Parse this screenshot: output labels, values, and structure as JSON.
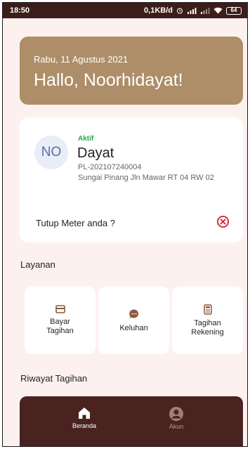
{
  "status_bar": {
    "time": "18:50",
    "network_speed": "0,1KB/d",
    "battery": "64"
  },
  "greeting": {
    "date": "Rabu, 11 Agustus 2021",
    "hello": "Hallo, Noorhidayat!"
  },
  "customer": {
    "initials": "NO",
    "status": "Aktif",
    "name": "Dayat",
    "id": "PL-202107240004",
    "address": "Sungai Pinang Jln Mawar RT 04 RW 02",
    "close_meter_label": "Tutup Meter anda ?"
  },
  "services": {
    "title": "Layanan",
    "items": [
      {
        "label": "Bayar\nTagihan",
        "icon": "card-icon"
      },
      {
        "label": "Keluhan",
        "icon": "chat-bubble-icon"
      },
      {
        "label": "Tagihan\nRekening",
        "icon": "calculator-icon"
      }
    ]
  },
  "history": {
    "title": "Riwayat Tagihan"
  },
  "bottom_nav": {
    "items": [
      {
        "label": "Beranda",
        "icon": "home-icon",
        "active": true
      },
      {
        "label": "Akun",
        "icon": "account-icon",
        "active": false
      }
    ]
  },
  "colors": {
    "background": "#fdf1ef",
    "greeting_card": "#ad8e68",
    "nav_bar": "#4a2321",
    "status_active": "#1fa84a",
    "close_icon": "#d9263a",
    "service_icon": "#8b5a3c"
  }
}
